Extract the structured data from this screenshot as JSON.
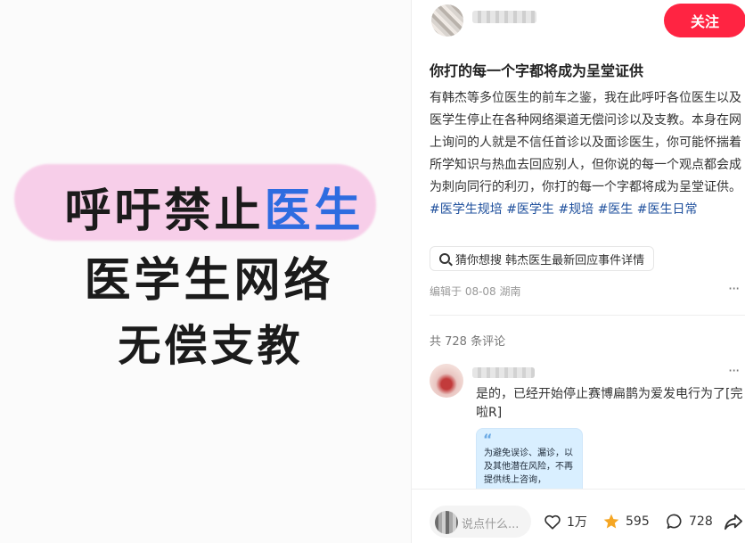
{
  "poster": {
    "line1_prefix": "呼吁禁止",
    "line1_accent": "医生",
    "line2": "医学生网络",
    "line3": "无偿支教"
  },
  "author": {
    "follow_label": "关注"
  },
  "post": {
    "title": "你打的每一个字都将成为呈堂证供",
    "body": "有韩杰等多位医生的前车之鉴，我在此呼吁各位医生以及医学生停止在各种网络渠道无偿问诊以及支教。本身在网上询问的人就是不信任首诊以及面诊医生，你可能怀揣着所学知识与热血去回应别人，但你说的每一个观点都会成为刺向同行的利刃，你打的每一个字都将成为呈堂证供。",
    "tags": [
      "#医学生规培",
      "#医学生",
      "#规培",
      "#医生",
      "#医生日常"
    ],
    "search_chip": "猜你想搜  韩杰医生最新回应事件详情",
    "meta": "编辑于  08-08  湖南",
    "more": "···"
  },
  "comments": {
    "count_label": "共 728 条评论",
    "items": [
      {
        "text": "是的，已经开始停止赛博扁鹊为爱发电行为了[完啦R]",
        "image_quote": "“",
        "image_text": "为避免误诊、漏诊，以及其他潜在风险，不再提供线上咨询，",
        "more": "···"
      }
    ]
  },
  "bottom": {
    "input_placeholder": "说点什么...",
    "likes": "1万",
    "stars": "595",
    "comments": "728"
  },
  "icons": {
    "like": "heart-icon",
    "star": "star-icon",
    "comment": "comment-bubble-icon",
    "share": "share-icon",
    "search": "search-icon"
  },
  "colors": {
    "accent": "#ff2442",
    "tag": "#1e4f9c",
    "poster_highlight": "#f7c7e6",
    "poster_accent_text": "#2e6ce0",
    "star": "#f5a623"
  }
}
